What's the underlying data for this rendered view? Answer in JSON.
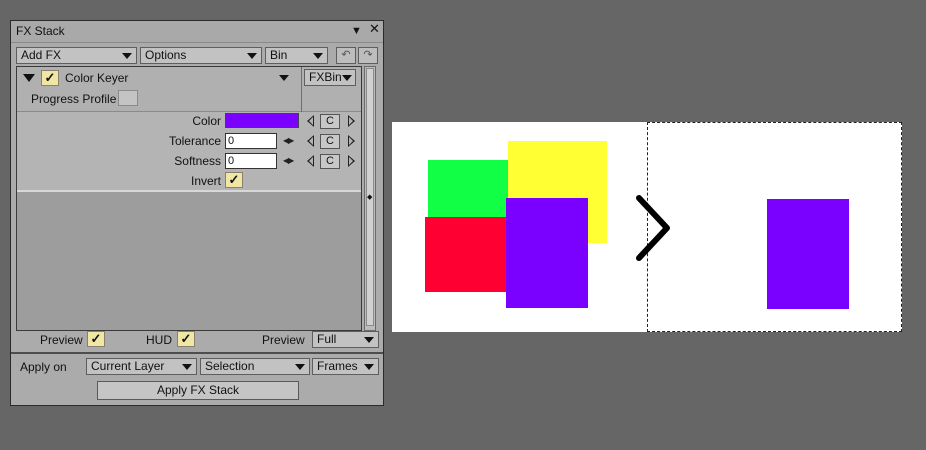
{
  "panel": {
    "title": "FX Stack",
    "toolbar": {
      "add_fx": "Add FX",
      "options": "Options",
      "bin": "Bin"
    },
    "fx": {
      "name": "Color Keyer",
      "bin_label": "FXBin",
      "progress_profile_label": "Progress Profile",
      "params": {
        "color_label": "Color",
        "color_value": "#7a00ff",
        "tolerance_label": "Tolerance",
        "tolerance_value": "0",
        "softness_label": "Softness",
        "softness_value": "0",
        "invert_label": "Invert",
        "reset_label": "C"
      }
    },
    "footer": {
      "preview_label": "Preview",
      "hud_label": "HUD",
      "preview_mode_label": "Preview",
      "preview_mode_value": "Full"
    },
    "apply": {
      "apply_on_label": "Apply on",
      "layer_value": "Current Layer",
      "selection_value": "Selection",
      "frames_value": "Frames",
      "apply_button": "Apply FX Stack"
    }
  },
  "illustration": {
    "colors": {
      "green": "#11ff44",
      "yellow": "#ffff33",
      "red": "#ff0033",
      "purple": "#7a00ff"
    },
    "arrow_icon": "chevron-right-icon"
  }
}
